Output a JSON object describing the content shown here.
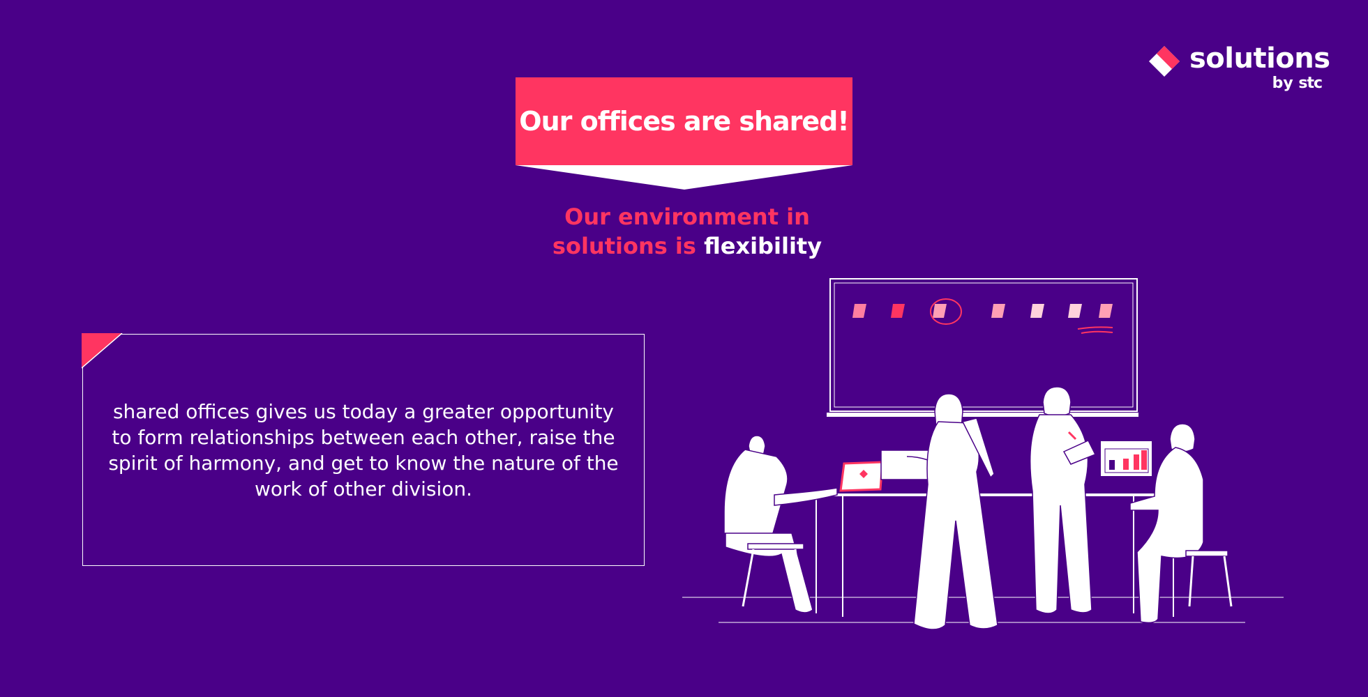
{
  "brand": {
    "name": "solutions",
    "by": "by",
    "company": "stc",
    "colors": {
      "background": "#4a0088",
      "accent": "#ff3561",
      "text": "#ffffff"
    }
  },
  "banner": {
    "title": "Our offices are shared!"
  },
  "tagline": {
    "line1": "Our environment in",
    "line2_prefix": "solutions is",
    "highlight": "flexibility"
  },
  "card": {
    "body": "shared offices gives us today a greater opportunity to form relationships between each other, raise the spirit of harmony, and get to know the nature of the work of other division."
  },
  "illustration": {
    "icon": "shared-office-people-icon"
  }
}
